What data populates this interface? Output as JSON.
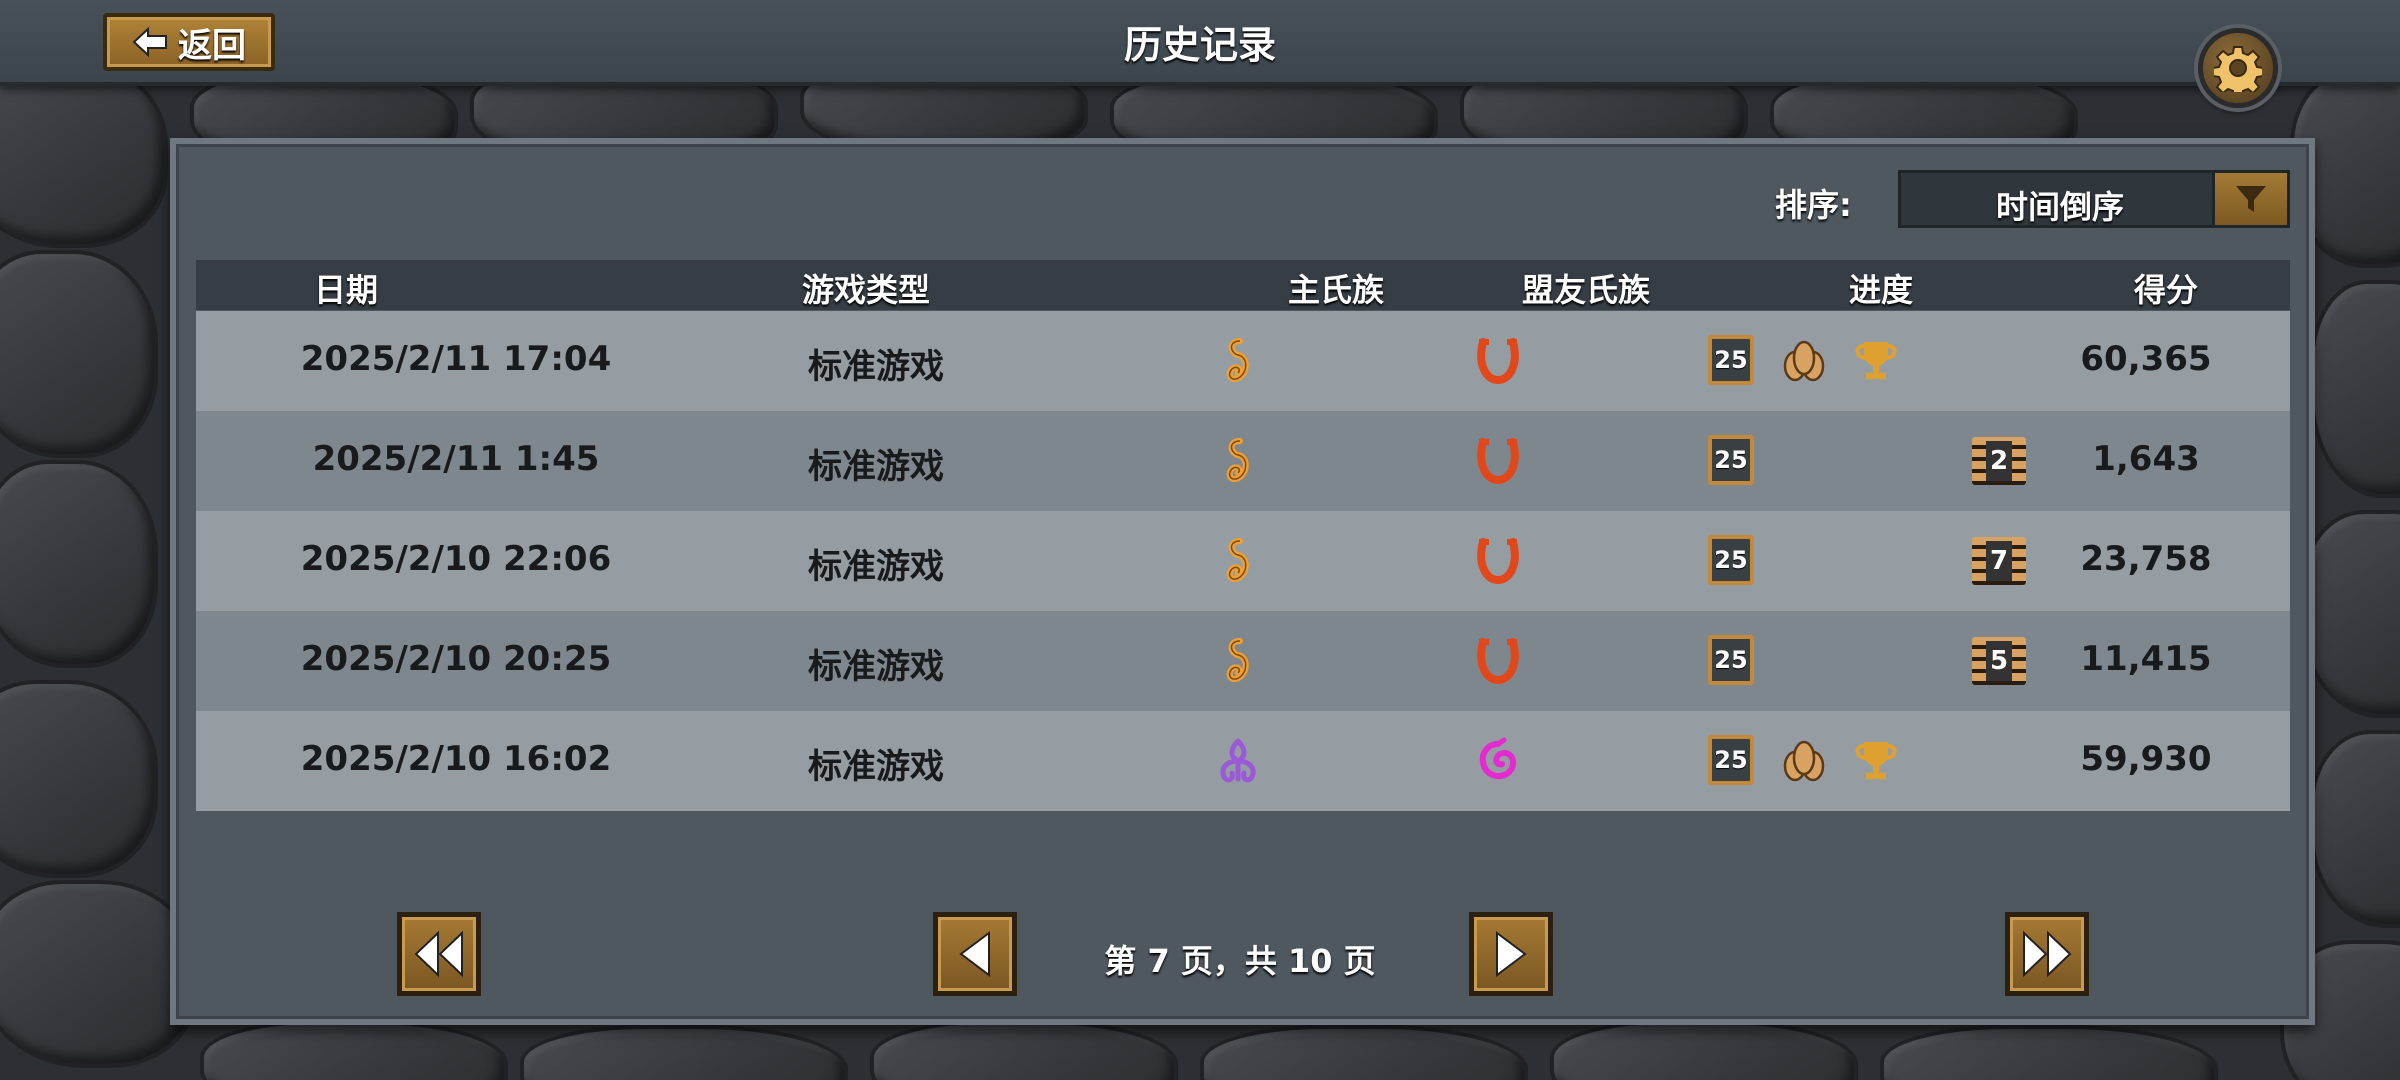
{
  "header": {
    "title": "历史记录",
    "back_label": "返回"
  },
  "sort": {
    "label": "排序:",
    "value": "时间倒序"
  },
  "columns": [
    "日期",
    "游戏类型",
    "主氏族",
    "盟友氏族",
    "进度",
    "得分"
  ],
  "rows": [
    {
      "date": "2025/2/11 17:04",
      "type": "标准游戏",
      "main_clan": "orange-clan-icon",
      "ally_clan": "red-horseshoe-clan-icon",
      "level": "25",
      "progress": "victory",
      "score": "60,365"
    },
    {
      "date": "2025/2/11 1:45",
      "type": "标准游戏",
      "main_clan": "orange-clan-icon",
      "ally_clan": "red-horseshoe-clan-icon",
      "level": "25",
      "progress": "2",
      "score": "1,643"
    },
    {
      "date": "2025/2/10 22:06",
      "type": "标准游戏",
      "main_clan": "orange-clan-icon",
      "ally_clan": "red-horseshoe-clan-icon",
      "level": "25",
      "progress": "7",
      "score": "23,758"
    },
    {
      "date": "2025/2/10 20:25",
      "type": "标准游戏",
      "main_clan": "orange-clan-icon",
      "ally_clan": "red-horseshoe-clan-icon",
      "level": "25",
      "progress": "5",
      "score": "11,415"
    },
    {
      "date": "2025/2/10 16:02",
      "type": "标准游戏",
      "main_clan": "purple-clan-icon",
      "ally_clan": "pink-spiral-clan-icon",
      "level": "25",
      "progress": "victory",
      "score": "59,930"
    }
  ],
  "pager": {
    "text": "第 7 页，共 10 页",
    "current": 7,
    "total": 10
  },
  "colors": {
    "orange_clan": "#f0a030",
    "red_clan": "#e0481c",
    "purple_clan": "#9a5ad8",
    "pink_clan": "#e42ad0",
    "gold": "#e0a030"
  }
}
